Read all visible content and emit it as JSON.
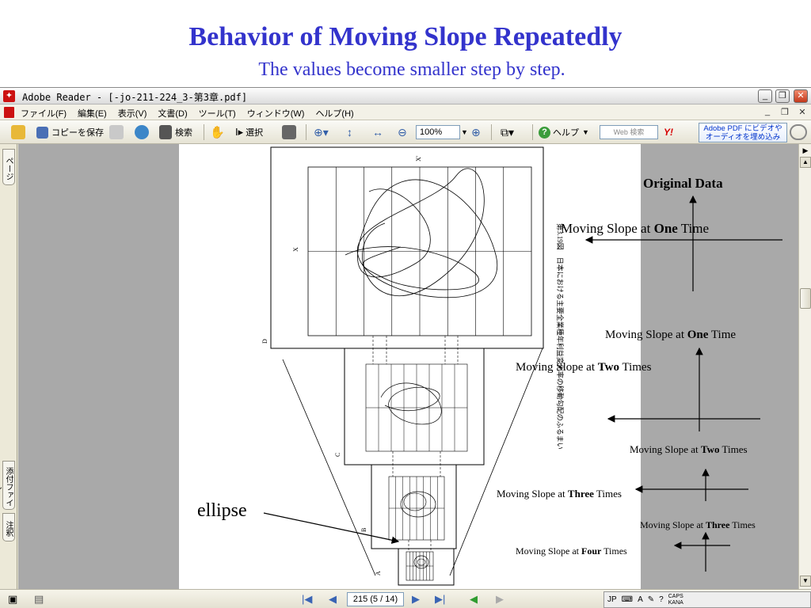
{
  "slide": {
    "title": "Behavior of Moving Slope Repeatedly",
    "subtitle": "The values become smaller step by step."
  },
  "window": {
    "title": "Adobe Reader - [-jo-211-224_3-第3章.pdf]",
    "app_icon": "adobe-reader-icon",
    "buttons": [
      "minimize",
      "restore",
      "close"
    ]
  },
  "menu": {
    "items": [
      "ファイル(F)",
      "編集(E)",
      "表示(V)",
      "文書(D)",
      "ツール(T)",
      "ウィンドウ(W)",
      "ヘルプ(H)"
    ]
  },
  "toolbar": {
    "save_copy_label": "コピーを保存",
    "search_label": "検索",
    "select_label": "選択",
    "zoom_value": "100%",
    "help_label": "ヘルプ",
    "web_search_placeholder": "Web 検索",
    "yahoo_label": "Y!",
    "adobe_ad_line1": "Adobe PDF にビデオや",
    "adobe_ad_line2": "オーディオを埋め込み"
  },
  "side_tabs": {
    "pages": "ページ",
    "attachments": "添付ファイル",
    "comments": "注釈"
  },
  "statusbar": {
    "page_indicator": "215 (5 / 14)",
    "ime_language": "JP",
    "ime_mode": "A",
    "caps": "CAPS",
    "kana": "KANA"
  },
  "document": {
    "caption_vertical": "第3.19図　日本における主要全業種年利益変化率の移動勾配のふるまい",
    "panel_labels": [
      "D",
      "C",
      "B",
      "A"
    ],
    "axis_x_label": "X",
    "axis_y_label": "X'"
  },
  "annotations": {
    "original_data": "Original Data",
    "one_time_top_prefix": "Moving Slope at ",
    "one_time_top_bold": "One",
    "one_time_top_suffix": " Time",
    "one_time_prefix": "Moving Slope at ",
    "one_time_bold": "One",
    "one_time_suffix": " Time",
    "two_times_top_prefix": "Moving Slope at ",
    "two_times_top_bold": "Two",
    "two_times_top_suffix": " Times",
    "two_times_prefix": "Moving Slope at ",
    "two_times_bold": "Two",
    "two_times_suffix": " Times",
    "three_times_left_prefix": "Moving Slope at ",
    "three_times_left_bold": "Three",
    "three_times_left_suffix": " Times",
    "three_times_prefix": "Moving Slope at ",
    "three_times_bold": "Three",
    "three_times_suffix": " Times",
    "four_times_prefix": "Moving Slope at ",
    "four_times_bold": "Four",
    "four_times_suffix": " Times",
    "ellipse": "ellipse"
  },
  "colors": {
    "title_blue": "#3333cc",
    "close_red": "#c4391c",
    "doc_background": "#a9a9a9"
  }
}
